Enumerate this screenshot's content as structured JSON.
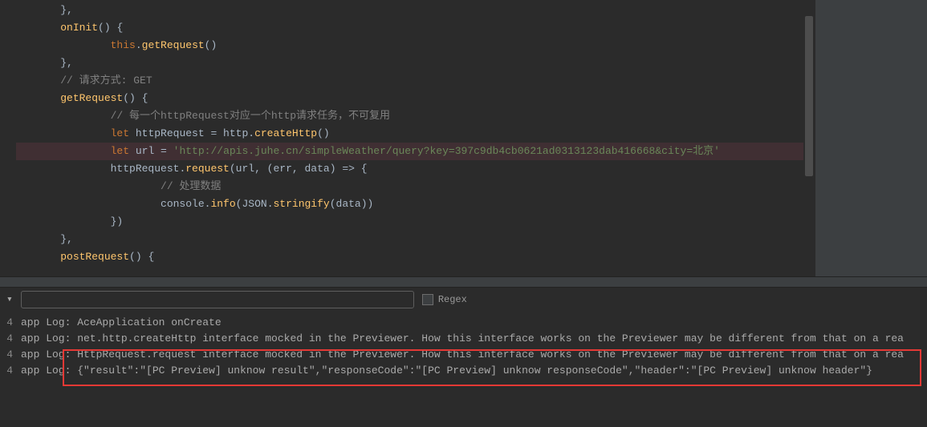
{
  "code": {
    "lines": [
      {
        "indent": 1,
        "segments": [
          {
            "t": "}",
            "c": "punct"
          },
          {
            "t": ",",
            "c": "punct"
          }
        ]
      },
      {
        "indent": 1,
        "segments": [
          {
            "t": "onInit",
            "c": "fn"
          },
          {
            "t": "()",
            "c": "paren"
          },
          {
            "t": " {",
            "c": "punct"
          }
        ]
      },
      {
        "indent": 3,
        "segments": [
          {
            "t": "this",
            "c": "this"
          },
          {
            "t": ".",
            "c": "punct"
          },
          {
            "t": "getRequest",
            "c": "fn"
          },
          {
            "t": "()",
            "c": "paren"
          }
        ]
      },
      {
        "indent": 1,
        "segments": [
          {
            "t": "}",
            "c": "punct"
          },
          {
            "t": ",",
            "c": "punct"
          }
        ]
      },
      {
        "indent": 1,
        "segments": [
          {
            "t": "// 请求方式: GET",
            "c": "com"
          }
        ]
      },
      {
        "indent": 1,
        "segments": [
          {
            "t": "getRequest",
            "c": "fn"
          },
          {
            "t": "()",
            "c": "paren"
          },
          {
            "t": " {",
            "c": "punct"
          }
        ]
      },
      {
        "indent": 3,
        "segments": [
          {
            "t": "// 每一个httpRequest对应一个http请求任务，不可复用",
            "c": "com"
          }
        ]
      },
      {
        "indent": 3,
        "segments": [
          {
            "t": "let ",
            "c": "kw"
          },
          {
            "t": "httpRequest = http.",
            "c": "ident"
          },
          {
            "t": "createHttp",
            "c": "fn"
          },
          {
            "t": "()",
            "c": "paren"
          }
        ]
      },
      {
        "indent": 3,
        "highlighted": true,
        "segments": [
          {
            "t": "let ",
            "c": "kw"
          },
          {
            "t": "url = ",
            "c": "ident"
          },
          {
            "t": "'http://apis.juhe.cn/simpleWeather/query?key=397c9db4cb0621ad0313123dab416668&city=北京'",
            "c": "str"
          }
        ]
      },
      {
        "indent": 3,
        "segments": [
          {
            "t": "httpRequest.",
            "c": "ident"
          },
          {
            "t": "request",
            "c": "fn"
          },
          {
            "t": "(",
            "c": "paren"
          },
          {
            "t": "url",
            "c": "ident"
          },
          {
            "t": ", (",
            "c": "punct"
          },
          {
            "t": "err",
            "c": "ident"
          },
          {
            "t": ", ",
            "c": "punct"
          },
          {
            "t": "data",
            "c": "ident"
          },
          {
            "t": ") => {",
            "c": "punct"
          }
        ]
      },
      {
        "indent": 5,
        "segments": [
          {
            "t": "// 处理数据",
            "c": "com"
          }
        ]
      },
      {
        "indent": 5,
        "segments": [
          {
            "t": "console.",
            "c": "ident"
          },
          {
            "t": "info",
            "c": "fn"
          },
          {
            "t": "(",
            "c": "paren"
          },
          {
            "t": "JSON.",
            "c": "ident"
          },
          {
            "t": "stringify",
            "c": "fn"
          },
          {
            "t": "(",
            "c": "paren"
          },
          {
            "t": "data",
            "c": "ident"
          },
          {
            "t": "))",
            "c": "paren"
          }
        ]
      },
      {
        "indent": 3,
        "segments": [
          {
            "t": "})",
            "c": "punct"
          }
        ]
      },
      {
        "indent": 1,
        "segments": [
          {
            "t": "}",
            "c": "punct"
          },
          {
            "t": ",",
            "c": "punct"
          }
        ]
      },
      {
        "indent": 1,
        "segments": [
          {
            "t": "postRequest",
            "c": "fn"
          },
          {
            "t": "()",
            "c": "paren"
          },
          {
            "t": " {",
            "c": "punct"
          }
        ]
      }
    ]
  },
  "toolbar": {
    "search_placeholder": "",
    "regex_label": "Regex"
  },
  "log": {
    "prefix": "4",
    "lines": [
      "app Log: AceApplication onCreate",
      "app Log: net.http.createHttp interface mocked in the Previewer. How this interface works on the Previewer may be different from that on a rea",
      "app Log: HttpRequest.request interface mocked in the Previewer. How this interface works on the Previewer may be different from that on a rea",
      "app Log: {\"result\":\"[PC Preview] unknow result\",\"responseCode\":\"[PC Preview] unknow responseCode\",\"header\":\"[PC Preview] unknow header\"}"
    ]
  }
}
